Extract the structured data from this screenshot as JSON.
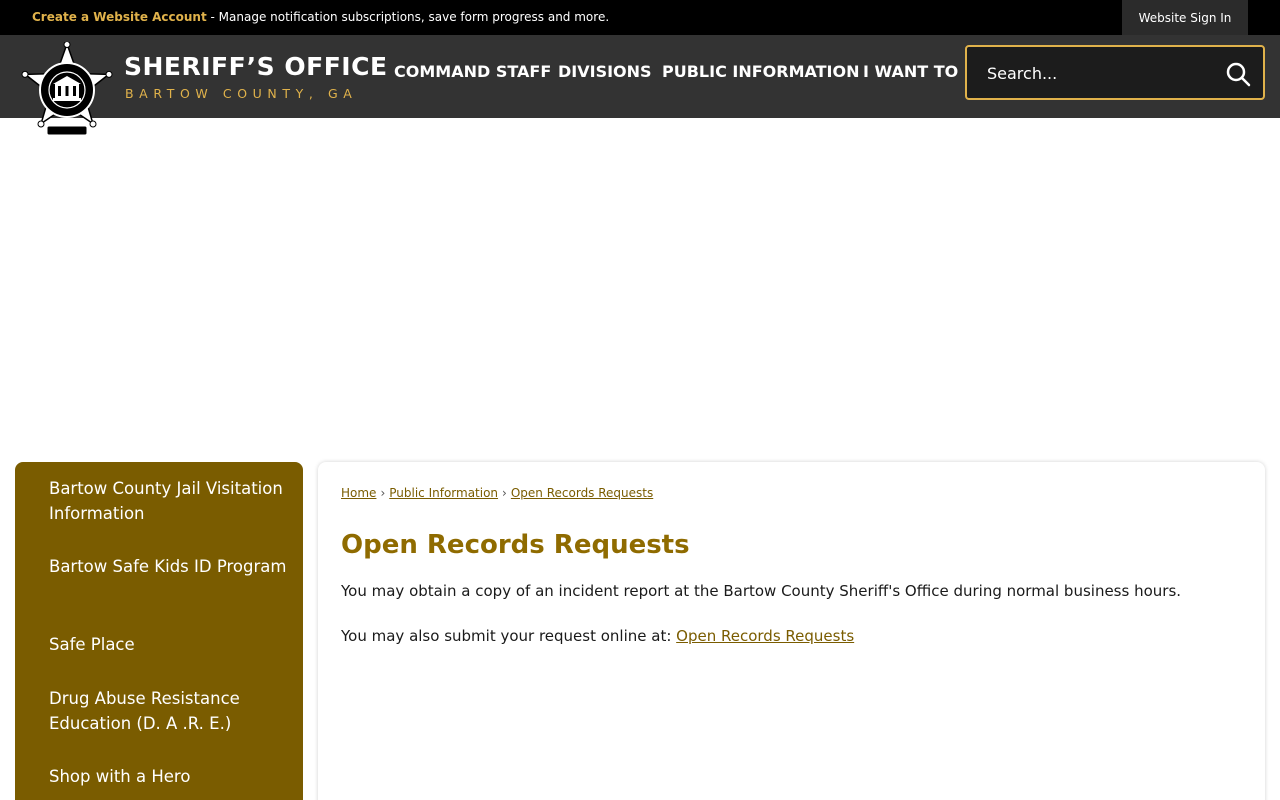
{
  "topbar": {
    "account_link": "Create a Website Account",
    "account_message": " - Manage notification subscriptions, save form progress and more.",
    "sign_in": "Website Sign In"
  },
  "brand": {
    "title": "SHERIFF’S OFFICE",
    "subtitle": "BARTOW COUNTY, GA"
  },
  "nav": {
    "items": [
      "COMMAND STAFF",
      "DIVISIONS",
      "PUBLIC INFORMATION",
      "I WANT TO"
    ]
  },
  "search": {
    "placeholder": "Search..."
  },
  "sidebar": {
    "items": [
      "Bartow County Jail Visitation Information",
      "Bartow Safe Kids ID Program",
      "Safe Place",
      "Drug Abuse Resistance Education (D. A .R. E.)",
      "Shop with a Hero"
    ]
  },
  "breadcrumb": {
    "items": [
      "Home",
      "Public Information",
      "Open Records Requests"
    ],
    "separator": "›"
  },
  "main": {
    "title": "Open Records Requests",
    "paragraph1": "You may obtain a copy of an incident report at the Bartow County Sheriff's Office during normal business hours.",
    "paragraph2_prefix": "You may also submit your request online at: ",
    "paragraph2_link": "Open Records Requests"
  },
  "colors": {
    "accent_gold": "#e0b24b",
    "sidebar_brown": "#7a5c00",
    "title_gold": "#8f6b00",
    "header_bg": "#333333",
    "topbar_bg": "#000000"
  },
  "icons": {
    "search": "magnifier-icon",
    "logo": "sheriff-star-badge"
  }
}
